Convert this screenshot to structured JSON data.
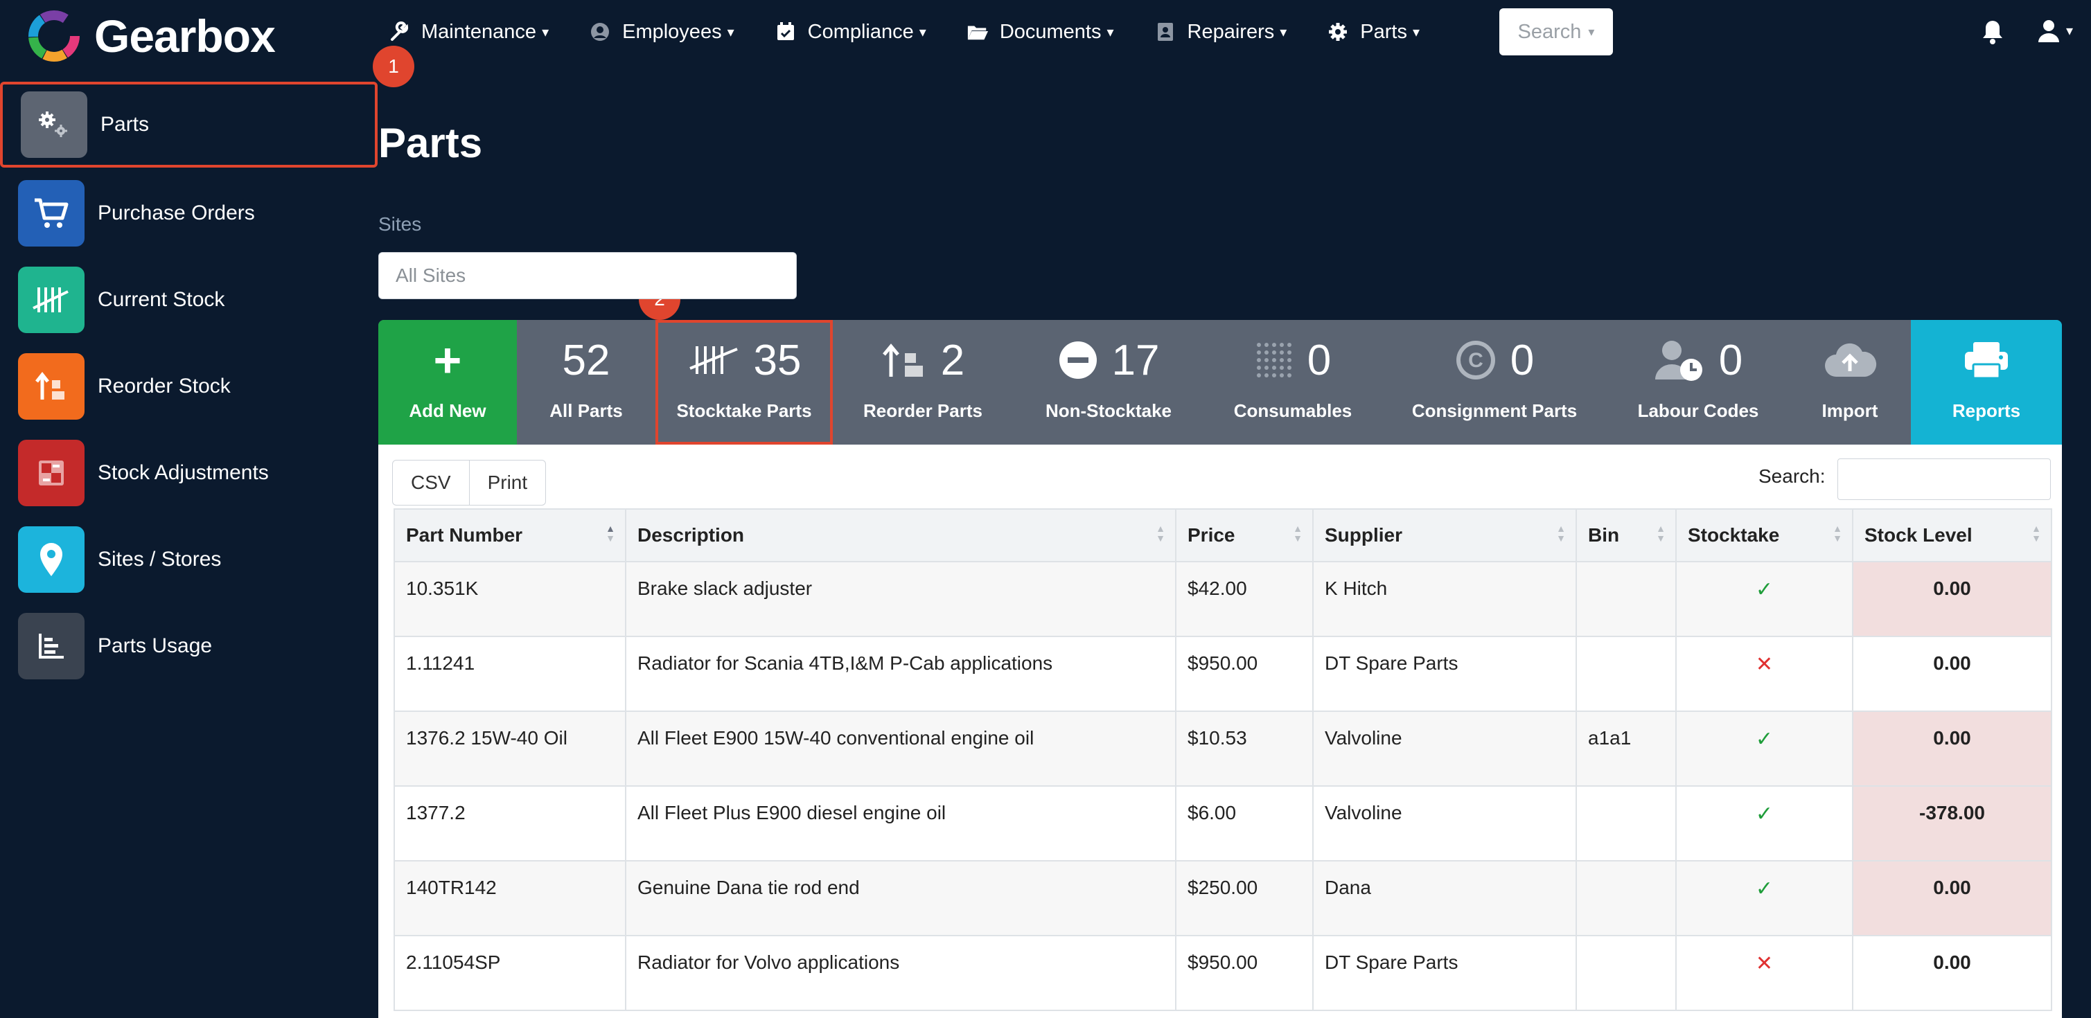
{
  "app": {
    "name": "Gearbox"
  },
  "nav": [
    {
      "label": "Maintenance",
      "icon": "wrench-icon"
    },
    {
      "label": "Employees",
      "icon": "user-circle-icon"
    },
    {
      "label": "Compliance",
      "icon": "calendar-check-icon"
    },
    {
      "label": "Documents",
      "icon": "folder-icon"
    },
    {
      "label": "Repairers",
      "icon": "contact-card-icon"
    },
    {
      "label": "Parts",
      "icon": "gear-icon"
    }
  ],
  "search": {
    "label": "Search"
  },
  "sidebar": {
    "items": [
      {
        "label": "Parts",
        "icon": "gears-icon",
        "color": "#5d6572",
        "active": true
      },
      {
        "label": "Purchase Orders",
        "icon": "cart-icon",
        "color": "#2360b6"
      },
      {
        "label": "Current Stock",
        "icon": "tally-icon",
        "color": "#1fb48f"
      },
      {
        "label": "Reorder Stock",
        "icon": "reorder-icon",
        "color": "#f26b1d"
      },
      {
        "label": "Stock Adjustments",
        "icon": "adjust-icon",
        "color": "#c42a2a"
      },
      {
        "label": "Sites / Stores",
        "icon": "map-pin-icon",
        "color": "#1cb4dc"
      },
      {
        "label": "Parts Usage",
        "icon": "chart-icon",
        "color": "#3a4350"
      }
    ]
  },
  "annotations": {
    "badge1": "1",
    "badge2": "2"
  },
  "main": {
    "title": "Parts",
    "sites_label": "Sites",
    "sites_placeholder": "All Sites"
  },
  "tiles": [
    {
      "label": "Add New",
      "value": "",
      "icon": "plus-icon"
    },
    {
      "label": "All Parts",
      "value": "52",
      "icon": ""
    },
    {
      "label": "Stocktake Parts",
      "value": "35",
      "icon": "tally-icon"
    },
    {
      "label": "Reorder Parts",
      "value": "2",
      "icon": "reorder-icon"
    },
    {
      "label": "Non-Stocktake",
      "value": "17",
      "icon": "minus-circle-icon"
    },
    {
      "label": "Consumables",
      "value": "0",
      "icon": "dots-grid-icon"
    },
    {
      "label": "Consignment Parts",
      "value": "0",
      "icon": "c-circle-icon"
    },
    {
      "label": "Labour Codes",
      "value": "0",
      "icon": "user-clock-icon"
    },
    {
      "label": "Import",
      "value": "",
      "icon": "cloud-upload-icon"
    },
    {
      "label": "Reports",
      "value": "",
      "icon": "printer-icon"
    }
  ],
  "table": {
    "export": {
      "csv": "CSV",
      "print": "Print"
    },
    "search_label": "Search:",
    "columns": [
      "Part Number",
      "Description",
      "Price",
      "Supplier",
      "Bin",
      "Stocktake",
      "Stock Level"
    ],
    "rows": [
      {
        "part": "10.351K",
        "desc": "Brake slack adjuster",
        "price": "$42.00",
        "supplier": "K Hitch",
        "bin": "",
        "stocktake": true,
        "stock": "0.00"
      },
      {
        "part": "1.11241",
        "desc": "Radiator for Scania 4TB,I&M P-Cab applications",
        "price": "$950.00",
        "supplier": "DT Spare Parts",
        "bin": "",
        "stocktake": false,
        "stock": "0.00"
      },
      {
        "part": "1376.2 15W-40 Oil",
        "desc": "All Fleet E900 15W-40 conventional engine oil",
        "price": "$10.53",
        "supplier": "Valvoline",
        "bin": "a1a1",
        "stocktake": true,
        "stock": "0.00"
      },
      {
        "part": "1377.2",
        "desc": "All Fleet Plus E900 diesel engine oil",
        "price": "$6.00",
        "supplier": "Valvoline",
        "bin": "",
        "stocktake": true,
        "stock": "-378.00"
      },
      {
        "part": "140TR142",
        "desc": "Genuine Dana tie rod end",
        "price": "$250.00",
        "supplier": "Dana",
        "bin": "",
        "stocktake": true,
        "stock": "0.00"
      },
      {
        "part": "2.11054SP",
        "desc": "Radiator for Volvo applications",
        "price": "$950.00",
        "supplier": "DT Spare Parts",
        "bin": "",
        "stocktake": false,
        "stock": "0.00"
      }
    ]
  },
  "colors": {
    "background": "#0b1a2e",
    "highlight": "#e0452e",
    "add_new": "#1fa347",
    "reports": "#14b3d3",
    "tile_bar": "#5b6472",
    "low_stock": "#f2dede"
  }
}
